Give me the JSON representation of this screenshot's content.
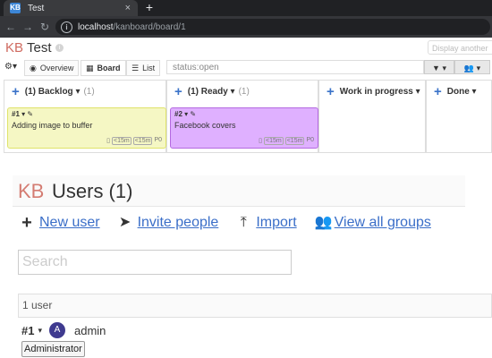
{
  "browser": {
    "tab_title": "Test",
    "favicon_text": "KB",
    "tab_close": "×",
    "new_tab": "+",
    "back": "←",
    "forward": "→",
    "reload": "↻",
    "url_host": "localhost",
    "url_path": "/kanboard/board/1"
  },
  "project": {
    "logo": "KB",
    "title": "Test",
    "info": "i",
    "switcher_placeholder": "Display another"
  },
  "views": {
    "gear": "⚙▾",
    "tabs": [
      {
        "icon": "◉",
        "label": "Overview",
        "active": false
      },
      {
        "icon": "▦",
        "label": "Board",
        "active": true
      },
      {
        "icon": "☰",
        "label": "List",
        "active": false
      }
    ],
    "filter_value": "status:open",
    "filter_button": "▼ ▾",
    "users_button": "👥 ▾"
  },
  "board": {
    "columns": [
      {
        "plus": "+",
        "title": "(1) Backlog ▾",
        "count": "(1)"
      },
      {
        "plus": "+",
        "title": "(1) Ready ▾",
        "count": "(1)"
      },
      {
        "plus": "+",
        "title": "Work in progress ▾",
        "count": ""
      },
      {
        "plus": "+",
        "title": "Done ▾",
        "count": ""
      }
    ],
    "tasks": [
      {
        "id": "#1 ▾ ✎",
        "title": "Adding image to buffer",
        "est1": "<15m",
        "est2": "<15m",
        "priority": "P0",
        "color": "#f5f7c4",
        "border": "#dfe36a"
      },
      {
        "id": "#2 ▾ ✎",
        "title": "Facebook covers",
        "est1": "<15m",
        "est2": "<15m",
        "priority": "P0",
        "color": "#dfb0ff",
        "border": "#b46ae0"
      }
    ]
  },
  "users": {
    "logo": "KB",
    "title": "Users (1)",
    "actions": [
      {
        "icon": "+",
        "label": "New user"
      },
      {
        "icon": "➤",
        "label": "Invite people"
      },
      {
        "icon": "⤒",
        "label": "Import"
      },
      {
        "icon": "👥",
        "label": "View all groups"
      }
    ],
    "search_placeholder": "Search",
    "count_label": "1 user",
    "list": [
      {
        "id": "#1",
        "caret": "▾",
        "avatar": "A",
        "name": "admin",
        "role": "Administrator"
      }
    ]
  }
}
